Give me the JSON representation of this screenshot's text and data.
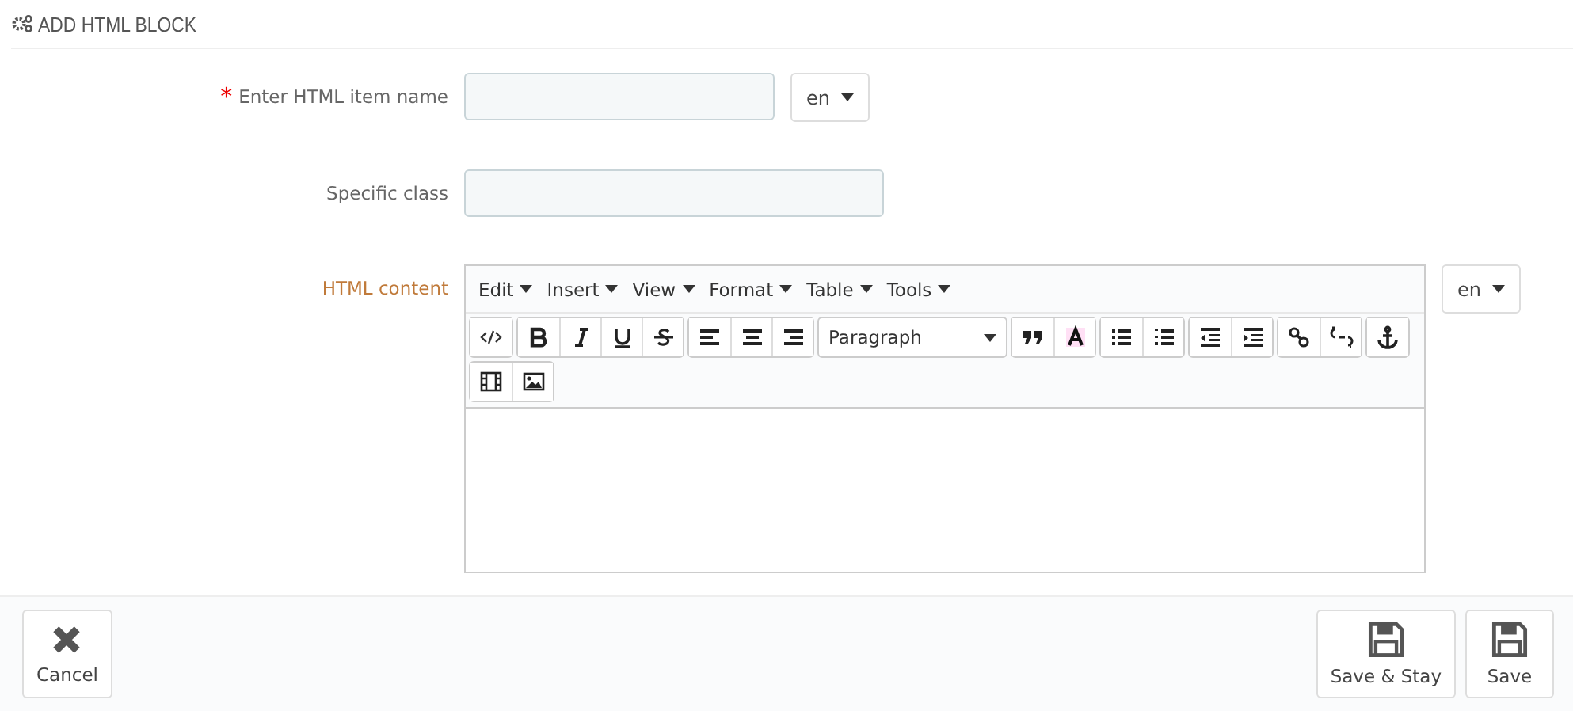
{
  "panel": {
    "title": "ADD HTML BLOCK"
  },
  "fields": [
    {
      "kind": "text",
      "label": "Enter HTML item name",
      "required_mark": "*",
      "highlighted": false,
      "lang": "en"
    },
    {
      "kind": "text",
      "label": "Specific class",
      "highlighted": false
    },
    {
      "kind": "editor",
      "label": "HTML content",
      "highlighted": true,
      "lang": "en",
      "menus": [
        "Edit",
        "Insert",
        "View",
        "Format",
        "Table",
        "Tools"
      ],
      "block_format": "Paragraph"
    }
  ],
  "footer": {
    "left": [
      {
        "label": "Cancel",
        "kind": "cancel"
      }
    ],
    "right": [
      {
        "label": "Save & Stay",
        "kind": "save"
      },
      {
        "label": "Save",
        "kind": "save"
      }
    ]
  }
}
